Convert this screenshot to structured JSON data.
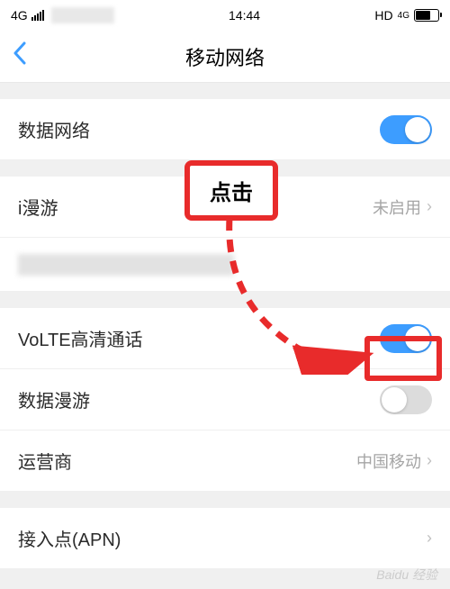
{
  "status_bar": {
    "network_type": "4G",
    "time": "14:44",
    "hd_label": "HD",
    "data_label": "4G"
  },
  "nav": {
    "title": "移动网络"
  },
  "rows": {
    "data_network": {
      "label": "数据网络",
      "toggle": true
    },
    "iroaming": {
      "label": "i漫游",
      "value": "未启用"
    },
    "volte": {
      "label": "VoLTE高清通话",
      "toggle": true
    },
    "data_roaming": {
      "label": "数据漫游",
      "toggle": false
    },
    "carrier": {
      "label": "运营商",
      "value": "中国移动"
    },
    "apn": {
      "label": "接入点(APN)"
    }
  },
  "annotation": {
    "click_label": "点击"
  },
  "watermark": "Baidu 经验",
  "colors": {
    "accent": "#3d9dff",
    "annotation_red": "#e82b2b"
  }
}
